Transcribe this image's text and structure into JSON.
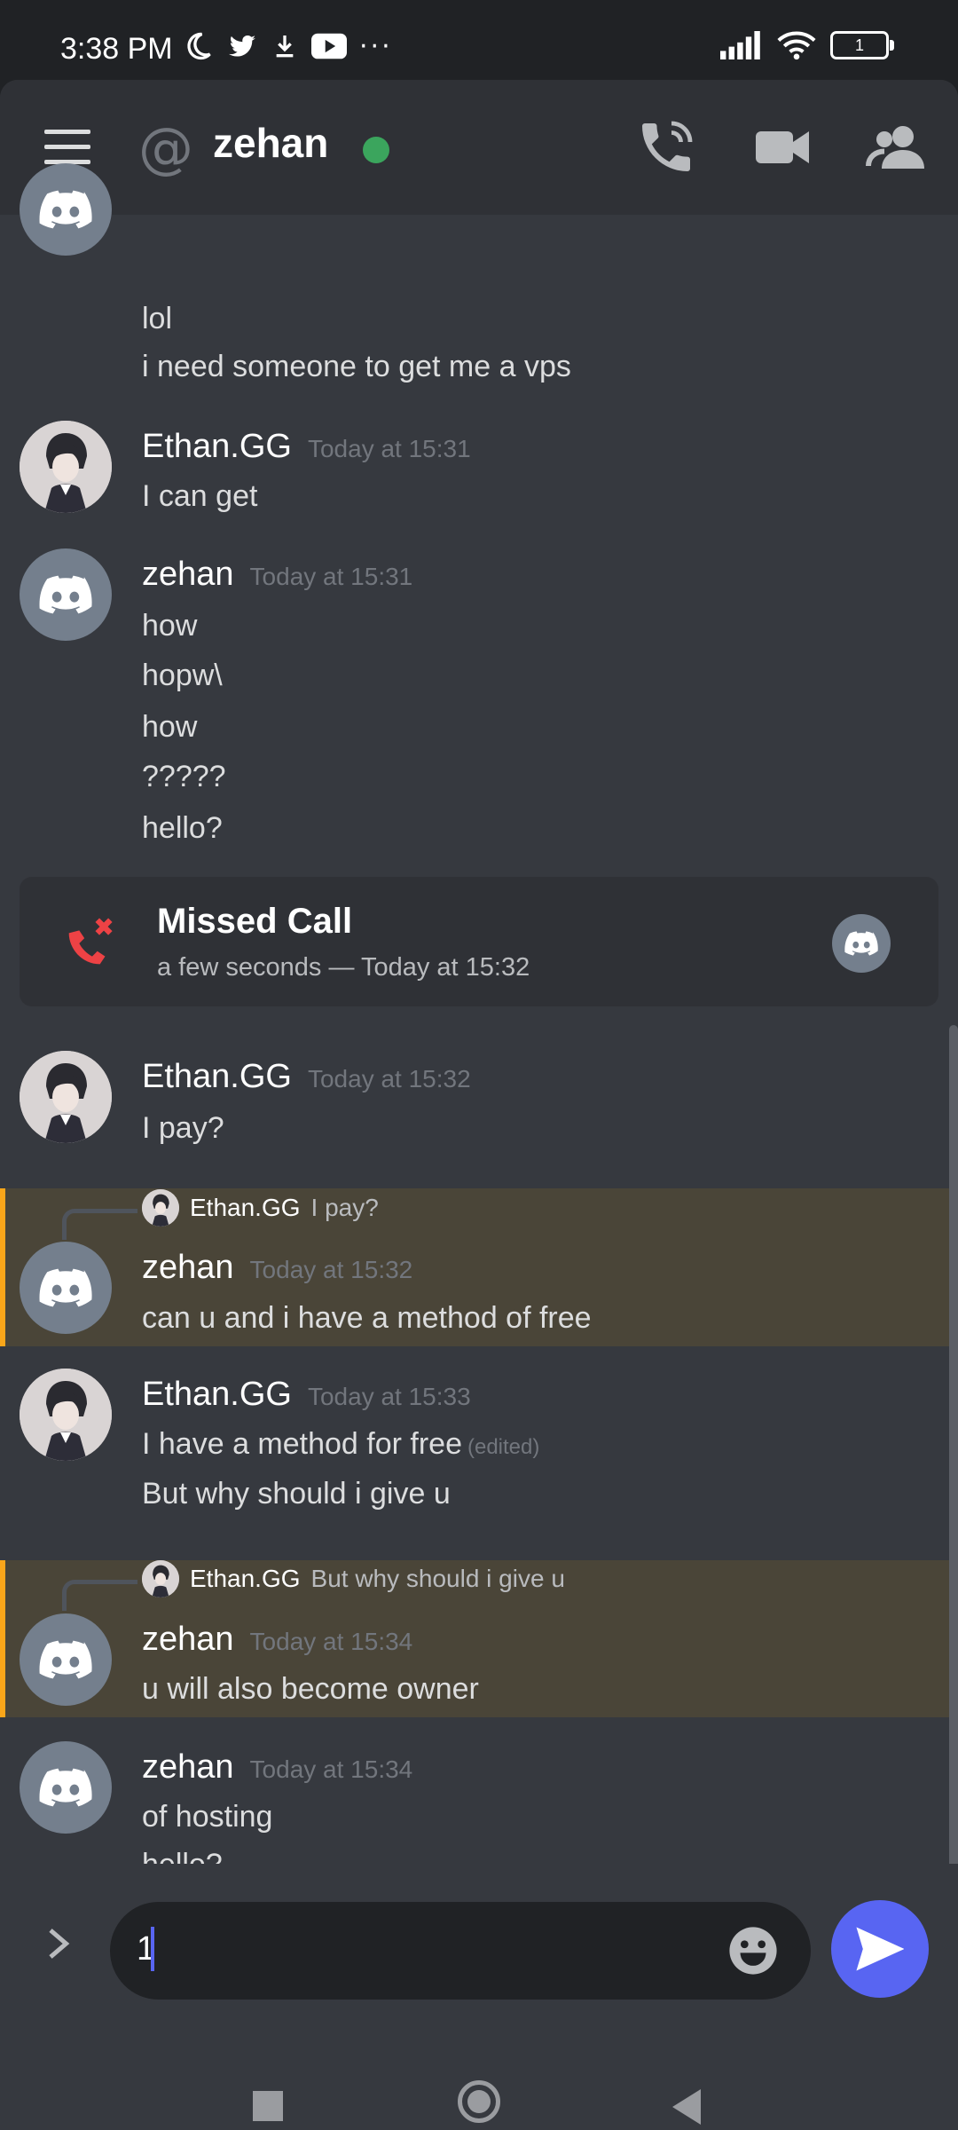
{
  "status_bar": {
    "time": "3:38 PM",
    "icons": [
      "moon-icon",
      "twitter-icon",
      "download-icon",
      "youtube-icon",
      "more-icon"
    ],
    "right_icons": [
      "signal-icon",
      "wifi-icon"
    ],
    "battery": "1"
  },
  "header": {
    "title": "zehan",
    "status": "online",
    "buttons": [
      "call-icon",
      "video-icon",
      "members-icon"
    ]
  },
  "messages": {
    "m0": {
      "lines": [
        "lol",
        "i need someone to get me a vps"
      ]
    },
    "m1": {
      "author": "Ethan.GG",
      "time": "Today at 15:31",
      "lines": [
        "I can get"
      ]
    },
    "m2": {
      "author": "zehan",
      "time": "Today at 15:31",
      "lines": [
        "how",
        "hopw\\",
        "how",
        "?????",
        "hello?"
      ]
    },
    "call": {
      "title": "Missed Call",
      "subtitle": "a few seconds — Today at 15:32"
    },
    "m3": {
      "author": "Ethan.GG",
      "time": "Today at 15:32",
      "lines": [
        "I pay?"
      ]
    },
    "m4": {
      "reply_author": "Ethan.GG",
      "reply_text": "I pay?",
      "author": "zehan",
      "time": "Today at 15:32",
      "lines": [
        "can u and i have a method of free"
      ]
    },
    "m5": {
      "author": "Ethan.GG",
      "time": "Today at 15:33",
      "lines": [
        "I have a method for free",
        "But why should i give u"
      ],
      "edited": "(edited)"
    },
    "m6": {
      "reply_author": "Ethan.GG",
      "reply_text": "But why should i give u",
      "author": "zehan",
      "time": "Today at 15:34",
      "lines": [
        "u will also become owner"
      ]
    },
    "m7": {
      "author": "zehan",
      "time": "Today at 15:34",
      "lines": [
        "of hosting",
        "hello?"
      ]
    }
  },
  "composer": {
    "value": "1"
  },
  "colors": {
    "accent": "#5865f2",
    "online": "#3ba55d",
    "mention_bar": "#faa61a",
    "missed_call": "#ed4245"
  }
}
